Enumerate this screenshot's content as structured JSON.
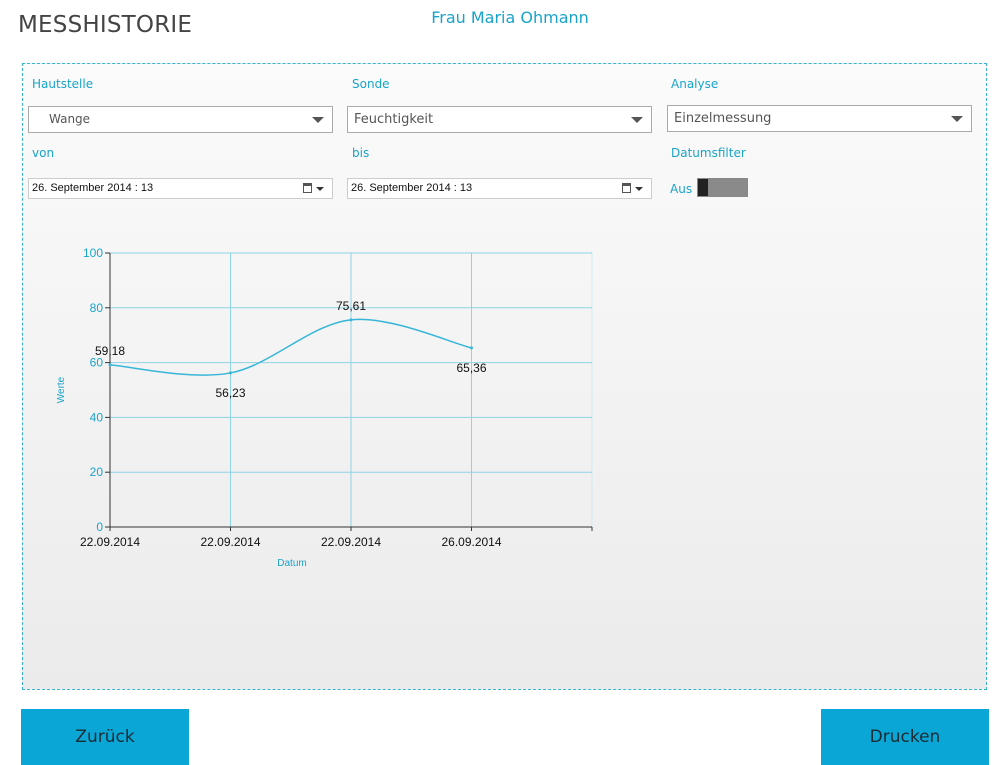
{
  "header": {
    "title": "MESSHISTORIE",
    "patient_name": "Frau Maria Ohmann"
  },
  "filters": {
    "hautstelle_label": "Hautstelle",
    "hautstelle_value": "Wange",
    "sonde_label": "Sonde",
    "sonde_value": "Feuchtigkeit",
    "analyse_label": "Analyse",
    "analyse_value": "Einzelmessung",
    "von_label": "von",
    "von_value": "26. September 2014 : 13",
    "bis_label": "bis",
    "bis_value": "26. September 2014 : 13",
    "datumsfilter_label": "Datumsfilter",
    "datumsfilter_state": "Aus"
  },
  "chart_data": {
    "type": "line",
    "categories": [
      "22.09.2014",
      "22.09.2014",
      "22.09.2014",
      "26.09.2014"
    ],
    "values": [
      59.18,
      56.23,
      75.61,
      65.36
    ],
    "data_labels": [
      "59,18",
      "56,23",
      "75,61",
      "65,36"
    ],
    "xlabel": "Datum",
    "ylabel": "Werte",
    "ylim": [
      0,
      100
    ],
    "yticks": [
      "0",
      "20",
      "40",
      "60",
      "80",
      "100"
    ],
    "grid": true,
    "color": "#37b6d8"
  },
  "buttons": {
    "back_label": "Zurück",
    "print_label": "Drucken"
  },
  "colors": {
    "accent": "#0aa6d6",
    "label": "#1aa3c9"
  }
}
